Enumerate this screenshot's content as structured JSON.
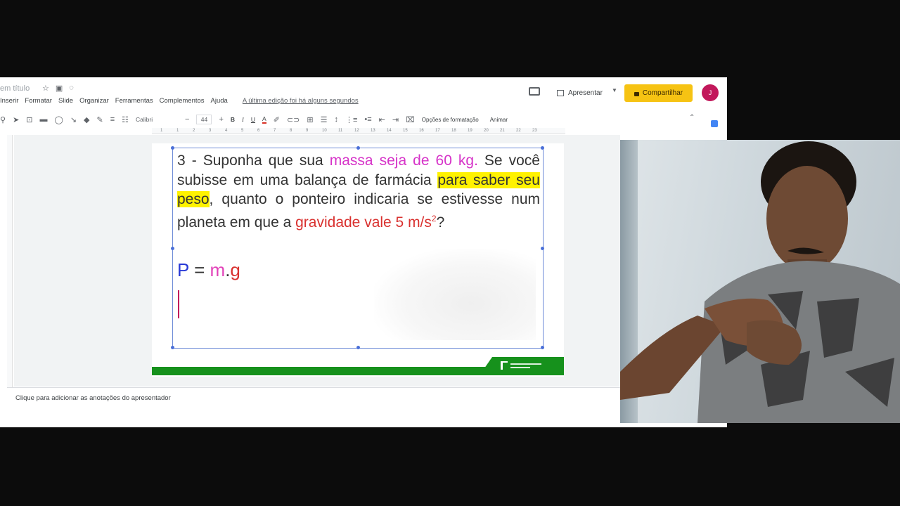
{
  "app": {
    "doc_title": "em título",
    "menu": [
      "Inserir",
      "Formatar",
      "Slide",
      "Organizar",
      "Ferramentas",
      "Complementos",
      "Ajuda"
    ],
    "last_edit": "A última edição foi há alguns segundos",
    "present_label": "Apresentar",
    "share_label": "Compartilhar",
    "avatar_letter": "J",
    "share_color": "#f6c313",
    "avatar_color": "#c2185b"
  },
  "toolbar": {
    "font": "Calibri",
    "font_size": "44",
    "bold": "B",
    "italic": "I",
    "underline": "U",
    "text_color": "A",
    "format_options": "Opções de formatação",
    "animate": "Animar"
  },
  "ruler": [
    "1",
    "1",
    "2",
    "3",
    "4",
    "5",
    "6",
    "7",
    "8",
    "9",
    "10",
    "11",
    "12",
    "13",
    "14",
    "15",
    "16",
    "17",
    "18",
    "19",
    "20",
    "21",
    "22",
    "23"
  ],
  "slide": {
    "question": {
      "p1": "3 - Suponha que sua ",
      "mass": "massa seja de 60 kg.",
      "p2": " Se você subisse em uma balança de farmácia ",
      "weigh": "para saber seu peso",
      "p3": ", quanto o ponteiro indicaria se estivesse num planeta em que a ",
      "gravity": "gravidade vale 5 m/s",
      "exponent": "2",
      "end": "?"
    },
    "formula": {
      "p": "P",
      "eq": " = ",
      "m": "m",
      "dot": ".",
      "g": "g"
    },
    "footer_color": "#16911c"
  },
  "notes": {
    "placeholder": "Clique para adicionar as anotações do apresentador"
  }
}
